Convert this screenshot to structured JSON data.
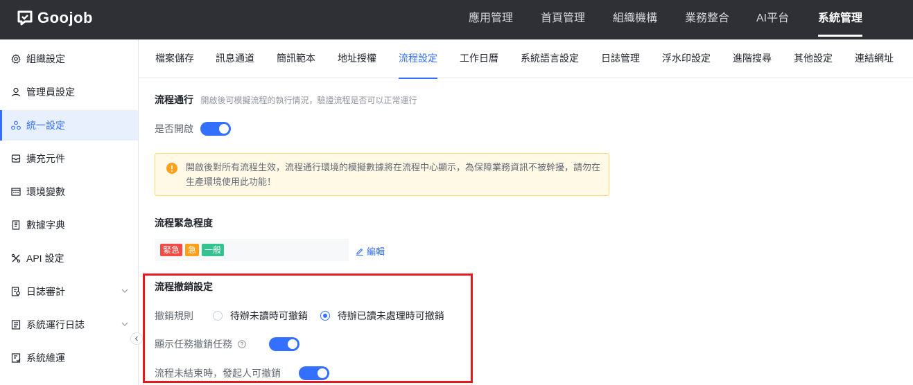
{
  "brand": {
    "name": "Goojob"
  },
  "topnav": {
    "items": [
      {
        "label": "應用管理",
        "active": false
      },
      {
        "label": "首頁管理",
        "active": false
      },
      {
        "label": "組織機構",
        "active": false
      },
      {
        "label": "業務整合",
        "active": false
      },
      {
        "label": "AI平台",
        "active": false
      },
      {
        "label": "系統管理",
        "active": true
      }
    ]
  },
  "sidebar": {
    "items": [
      {
        "label": "組織設定",
        "icon": "gear-icon"
      },
      {
        "label": "管理員設定",
        "icon": "user-icon"
      },
      {
        "label": "統一設定",
        "icon": "cluster-icon",
        "active": true
      },
      {
        "label": "擴充元件",
        "icon": "inbox-icon"
      },
      {
        "label": "環境變數",
        "icon": "window-icon"
      },
      {
        "label": "數據字典",
        "icon": "book-icon"
      },
      {
        "label": "API 設定",
        "icon": "api-icon"
      },
      {
        "label": "日誌審計",
        "icon": "audit-icon",
        "expandable": true
      },
      {
        "label": "系統運行日誌",
        "icon": "log-icon",
        "expandable": true
      },
      {
        "label": "系統維運",
        "icon": "maintenance-icon"
      }
    ]
  },
  "tabs": {
    "items": [
      {
        "label": "檔案儲存"
      },
      {
        "label": "訊息通道"
      },
      {
        "label": "簡訊範本"
      },
      {
        "label": "地址授權"
      },
      {
        "label": "流程設定",
        "active": true
      },
      {
        "label": "工作日曆"
      },
      {
        "label": "系統語言設定"
      },
      {
        "label": "日誌管理"
      },
      {
        "label": "浮水印設定"
      },
      {
        "label": "進階搜尋"
      },
      {
        "label": "其他設定"
      },
      {
        "label": "連結網址"
      }
    ]
  },
  "flow_run": {
    "title": "流程通行",
    "desc": "開啟後可模擬流程的執行情況，驗證流程是否可以正常運行",
    "toggle_label": "是否開啟",
    "toggle_on": true,
    "alert_text": "開啟後對所有流程生效，流程通行環境的模擬數據將在流程中心顯示，為保障業務資訊不被幹擾，請勿在生產環境使用此功能！"
  },
  "urgency": {
    "title": "流程緊急程度",
    "tags": [
      {
        "label": "緊急",
        "color": "#f54a45"
      },
      {
        "label": "急",
        "color": "#ff9f1a"
      },
      {
        "label": "一般",
        "color": "#34c38f"
      }
    ],
    "edit_label": "編輯"
  },
  "revoke": {
    "title": "流程撤銷設定",
    "rule_label": "撤銷規則",
    "options": [
      {
        "label": "待辦未讀時可撤銷",
        "checked": false
      },
      {
        "label": "待辦已讀未處理時可撤銷",
        "checked": true
      }
    ],
    "show_task_label": "顯示任務撤銷任務",
    "show_task_on": true,
    "initiator_label": "流程未結束時，發起人可撤銷",
    "initiator_on": true
  },
  "colors": {
    "accent": "#3370ff",
    "topbar": "#2e3035",
    "highlight_border": "#e5191c"
  }
}
